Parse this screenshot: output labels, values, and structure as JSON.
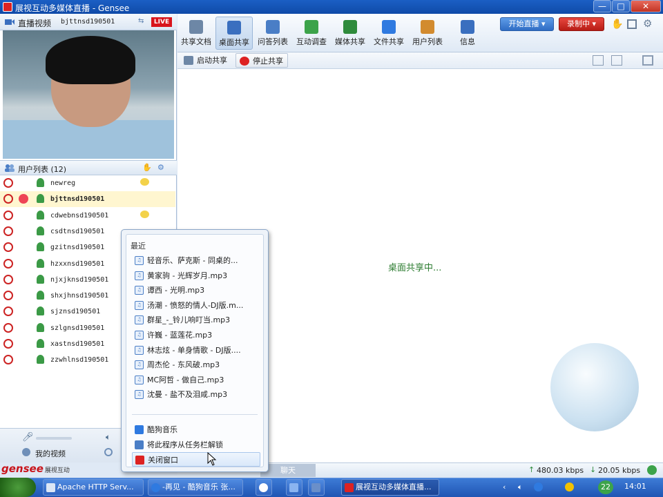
{
  "window": {
    "title": "展视互动多媒体直播 - Gensee",
    "minimize": "—",
    "maximize": "□",
    "close": "✕"
  },
  "video": {
    "label": "直播视频",
    "user": "bjttnsd190501",
    "live": "LIVE"
  },
  "userlist": {
    "title": "用户列表 (12)",
    "users": [
      {
        "name": "newreg",
        "chat": true,
        "bold": false
      },
      {
        "name": "bjttnsd190501",
        "chat": false,
        "bold": true
      },
      {
        "name": "cdwebnsd190501",
        "chat": true,
        "bold": false
      },
      {
        "name": "csdtnsd190501",
        "chat": false,
        "bold": false
      },
      {
        "name": "gzitnsd190501",
        "chat": false,
        "bold": false
      },
      {
        "name": "hzxxnsd190501",
        "chat": false,
        "bold": false
      },
      {
        "name": "njxjknsd190501",
        "chat": false,
        "bold": false
      },
      {
        "name": "shxjhnsd190501",
        "chat": false,
        "bold": false
      },
      {
        "name": "sjznsd190501",
        "chat": false,
        "bold": false
      },
      {
        "name": "szlgnsd190501",
        "chat": false,
        "bold": false
      },
      {
        "name": "xastnsd190501",
        "chat": false,
        "bold": false
      },
      {
        "name": "zzwhlnsd190501",
        "chat": false,
        "bold": false
      }
    ]
  },
  "footer": {
    "my_video": "我的视频"
  },
  "brand": {
    "logo": "gensee",
    "sub": "展视互动"
  },
  "toolbar": {
    "items": [
      "共享文档",
      "桌面共享",
      "问答列表",
      "互动调查",
      "媒体共享",
      "文件共享",
      "用户列表",
      "信息"
    ],
    "active_index": 1,
    "start_live": "开始直播 ▾",
    "recording": "录制中 ▾"
  },
  "subbar": {
    "start_share": "启动共享",
    "stop_share": "停止共享"
  },
  "main": {
    "sharing_message": "桌面共享中..."
  },
  "status": {
    "upload": "480.03 kbps",
    "download": "20.05 kbps",
    "behind": "聊天"
  },
  "jumplist": {
    "recent_header": "最近",
    "recent": [
      "轻音乐、萨克斯 - 同桌的...",
      "黄家驹 - 光辉岁月.mp3",
      "谭西 - 光明.mp3",
      "汤潮 - 愤怒的情人-DJ版.m...",
      "群星_-_铃儿响叮当.mp3",
      "许巍 - 蓝莲花.mp3",
      "林志炫 - 单身情歌 - DJ版....",
      "周杰伦 - 东风破.mp3",
      "MC阿哲 - 做自己.mp3",
      "沈曼 - 盐不及泪咸.mp3"
    ],
    "tasks": [
      "酷狗音乐",
      "将此程序从任务栏解锁",
      "关闭窗口"
    ]
  },
  "taskbar": {
    "items": [
      "Apache HTTP Serv...",
      "-再见 - 酷狗音乐 张...",
      "展视互动多媒体直播..."
    ],
    "clock": "14:01",
    "tray_number": "22"
  },
  "colors": {
    "accent": "#2f6cc4",
    "live": "#d8141b",
    "sharing": "#2e7d32"
  }
}
